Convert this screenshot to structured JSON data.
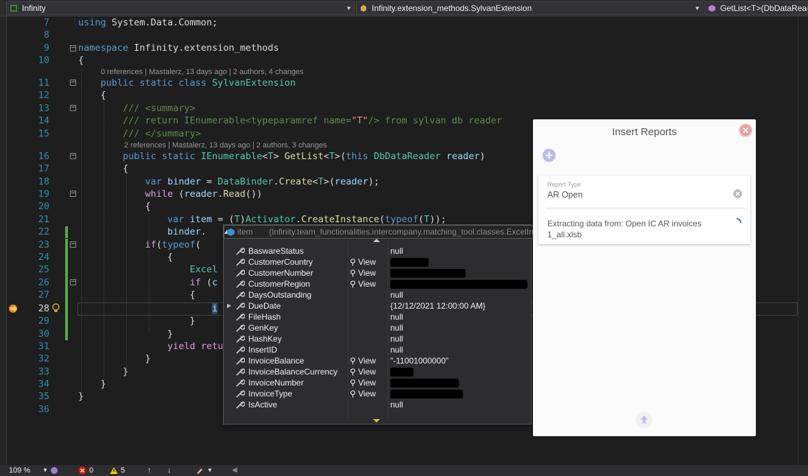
{
  "navbar": {
    "project": "Infinity",
    "type_scope": "Infinity.extension_methods.SylvanExtension",
    "member": "GetList<T>(DbDataReade"
  },
  "code": {
    "line_numbers": [
      "7",
      "8",
      "9",
      "10",
      "11",
      "12",
      "13",
      "14",
      "15",
      "16",
      "17",
      "18",
      "19",
      "20",
      "21",
      "22",
      "23",
      "24",
      "25",
      "26",
      "27",
      "28",
      "29",
      "30",
      "31",
      "32",
      "33",
      "34",
      "35",
      "36"
    ],
    "codelens": [
      "0 references | Mastalerz, 13 days ago | 2 authors, 4 changes",
      "2 references | Mastalerz, 13 days ago | 2 authors, 3 changes"
    ]
  },
  "datatip": {
    "header_var": "item",
    "header_type": "{Infinity.team_functionalities.intercompany.matching_tool.classes.ExcelInvoice}",
    "view_label": "View",
    "rows": [
      {
        "name": "BaswareStatus",
        "value": "null",
        "view": false,
        "redact": 0,
        "expand": false
      },
      {
        "name": "CustomerCountry",
        "value": "",
        "view": true,
        "redact": 56,
        "expand": false
      },
      {
        "name": "CustomerNumber",
        "value": "",
        "view": true,
        "redact": 110,
        "expand": false
      },
      {
        "name": "CustomerRegion",
        "value": "",
        "view": true,
        "redact": 200,
        "expand": false
      },
      {
        "name": "DaysOutstanding",
        "value": "null",
        "view": false,
        "redact": 0,
        "expand": false
      },
      {
        "name": "DueDate",
        "value": "{12/12/2021 12:00:00 AM}",
        "view": false,
        "redact": 0,
        "expand": true
      },
      {
        "name": "FileHash",
        "value": "null",
        "view": false,
        "redact": 0,
        "expand": false
      },
      {
        "name": "GenKey",
        "value": "null",
        "view": false,
        "redact": 0,
        "expand": false
      },
      {
        "name": "HashKey",
        "value": "null",
        "view": false,
        "redact": 0,
        "expand": false
      },
      {
        "name": "InsertID",
        "value": "null",
        "view": false,
        "redact": 0,
        "expand": false
      },
      {
        "name": "InvoiceBalance",
        "value": "\"-11001000000\"",
        "view": true,
        "redact": 0,
        "expand": false
      },
      {
        "name": "InvoiceBalanceCurrency",
        "value": "",
        "view": true,
        "redact": 34,
        "expand": false
      },
      {
        "name": "InvoiceNumber",
        "value": "",
        "view": true,
        "redact": 100,
        "expand": false
      },
      {
        "name": "InvoiceType",
        "value": "",
        "view": true,
        "redact": 106,
        "expand": false
      },
      {
        "name": "IsActive",
        "value": "null",
        "view": false,
        "redact": 0,
        "expand": false
      }
    ]
  },
  "panel": {
    "title": "Insert Reports",
    "report_type_label": "Report Type",
    "report_type_value": "AR Open",
    "status_line1": "Extracting data from: Open IC AR invoices",
    "status_line2": "1_all.xlsb"
  },
  "statusbar": {
    "zoom": "109 %",
    "errors": "0",
    "warnings": "5"
  },
  "colors": {
    "editor_bg": "#1e1e1e",
    "keyword": "#569cd6",
    "type": "#4ec9b0",
    "comment": "#57a64a",
    "line_number": "#2b91af",
    "panel_bg": "#fafafa",
    "accent_purple": "#b7bce8"
  }
}
